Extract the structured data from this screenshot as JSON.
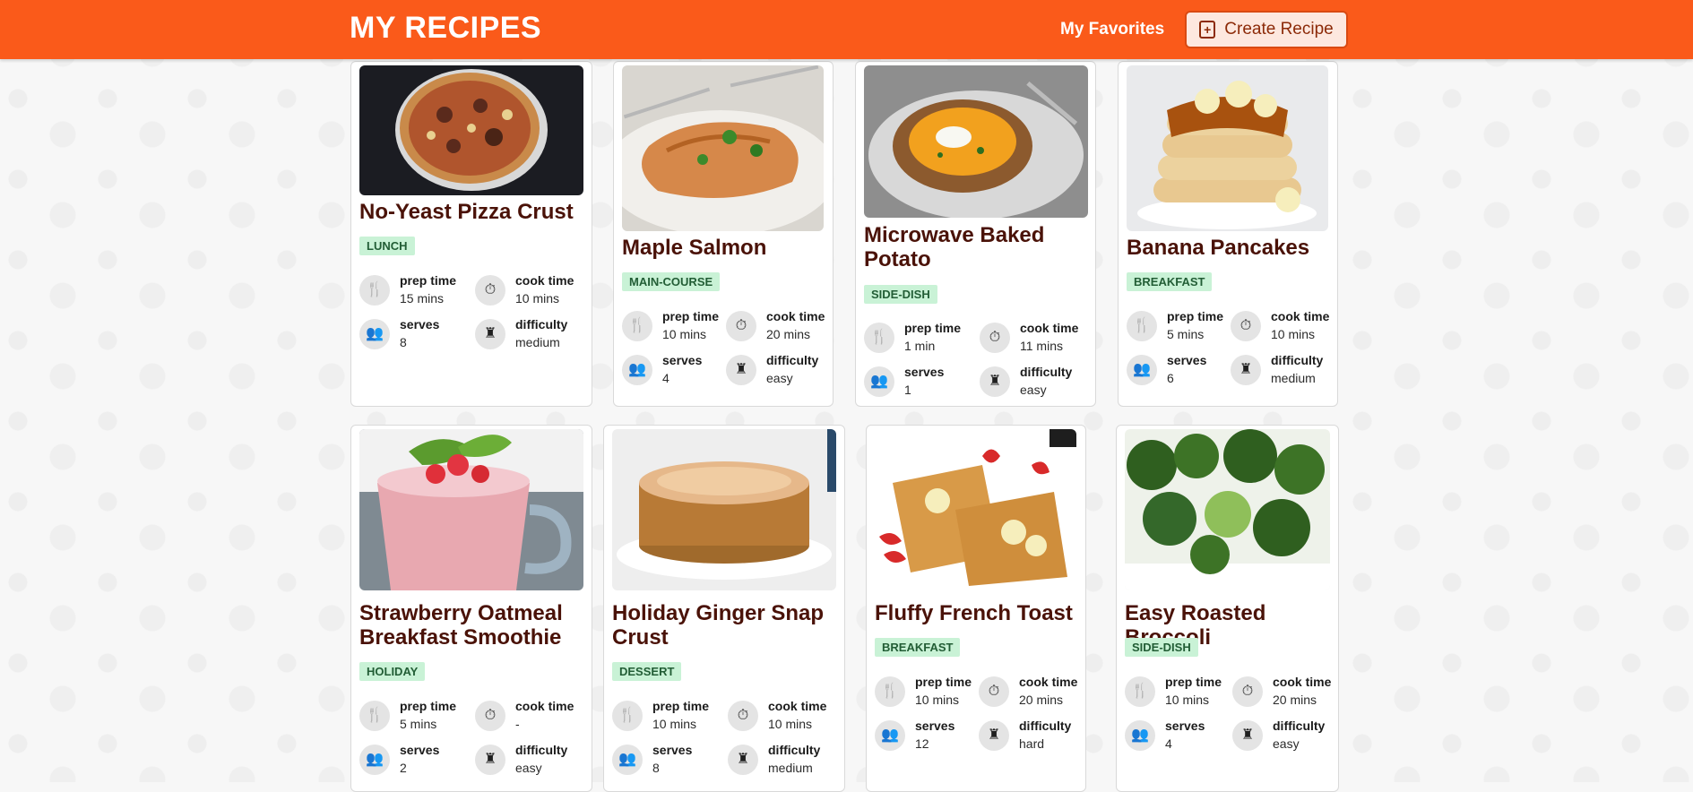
{
  "navbar": {
    "brand": "MY RECIPES",
    "favorites_label": "My Favorites",
    "create_label": "Create Recipe",
    "accent_color": "#fa5a1a"
  },
  "stat_labels": {
    "prep": "prep time",
    "cook": "cook time",
    "serves": "serves",
    "difficulty": "difficulty"
  },
  "recipes": [
    {
      "title": "No-Yeast Pizza Crust",
      "category": "LUNCH",
      "prep": "15 mins",
      "cook": "10 mins",
      "serves": "8",
      "difficulty": "medium",
      "image": "pizza"
    },
    {
      "title": "Maple Salmon",
      "category": "MAIN-COURSE",
      "prep": "10 mins",
      "cook": "20 mins",
      "serves": "4",
      "difficulty": "easy",
      "image": "salmon"
    },
    {
      "title": "Microwave Baked Potato",
      "category": "SIDE-DISH",
      "prep": "1 min",
      "cook": "11 mins",
      "serves": "1",
      "difficulty": "easy",
      "image": "potato"
    },
    {
      "title": "Banana Pancakes",
      "category": "BREAKFAST",
      "prep": "5 mins",
      "cook": "10 mins",
      "serves": "6",
      "difficulty": "medium",
      "image": "pancakes"
    },
    {
      "title": "Strawberry Oatmeal Breakfast Smoothie",
      "category": "HOLIDAY",
      "prep": "5 mins",
      "cook": "-",
      "serves": "2",
      "difficulty": "easy",
      "image": "smoothie"
    },
    {
      "title": "Holiday Ginger Snap Crust",
      "category": "DESSERT",
      "prep": "10 mins",
      "cook": "10 mins",
      "serves": "8",
      "difficulty": "medium",
      "image": "cheesecake"
    },
    {
      "title": "Fluffy French Toast",
      "category": "BREAKFAST",
      "prep": "10 mins",
      "cook": "20 mins",
      "serves": "12",
      "difficulty": "hard",
      "image": "french-toast"
    },
    {
      "title": "Easy Roasted Broccoli",
      "category": "SIDE-DISH",
      "prep": "10 mins",
      "cook": "20 mins",
      "serves": "4",
      "difficulty": "easy",
      "image": "broccoli"
    }
  ]
}
